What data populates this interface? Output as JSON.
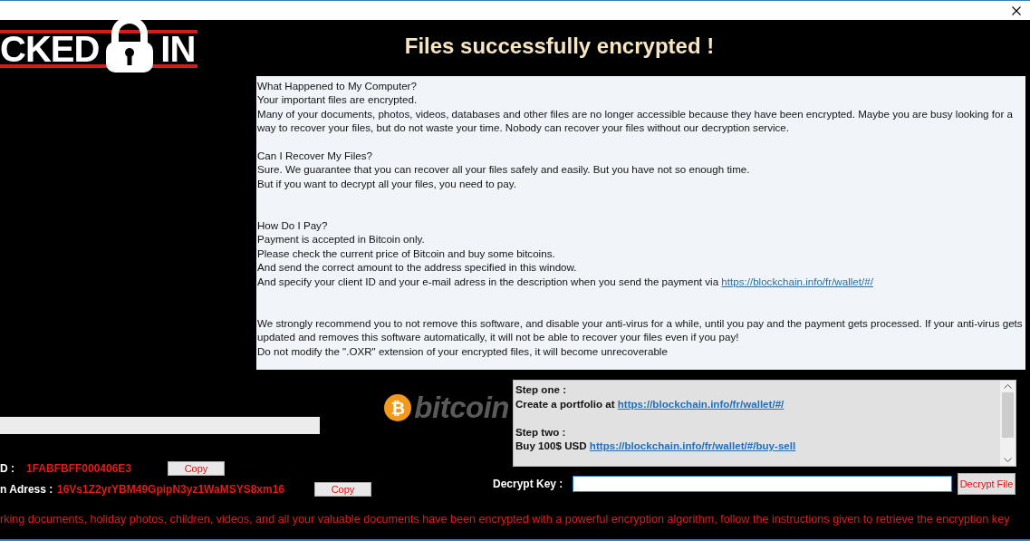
{
  "header": {
    "logo": {
      "left": "CKED",
      "right": "IN"
    },
    "title": "Files successfully encrypted !"
  },
  "note": {
    "sections": [
      {
        "lines": [
          {
            "text": "What Happened to My Computer?"
          },
          {
            "text": "Your important files are encrypted."
          },
          {
            "text": "Many of your documents, photos, videos, databases and other files are no longer accessible because they have been encrypted. Maybe you are busy looking for a way to recover your files, but do not waste your time. Nobody can recover your files without our decryption service."
          }
        ]
      },
      {
        "lines": [
          {
            "text": "Can I Recover My Files?"
          },
          {
            "text": "Sure. We guarantee that you can recover all your files safely and easily. But you have not so enough time."
          },
          {
            "text": "But if you want to decrypt all your files, you need to pay."
          }
        ]
      },
      {
        "lines": [
          {
            "text": "How Do I Pay?"
          },
          {
            "text": "Payment is accepted in Bitcoin only."
          },
          {
            "text": "Please check the current price of Bitcoin and buy some bitcoins."
          },
          {
            "text": "And send the correct amount to the address specified in this window."
          },
          {
            "text": "And specify your client ID and your e-mail adress in the description when you send the payment via",
            "link": "https://blockchain.info/fr/wallet/#/"
          }
        ]
      },
      {
        "lines": [
          {
            "text": "We strongly recommend you to not remove this software, and disable your anti-virus for a while, until you pay and the payment gets processed. If your anti-virus gets updated and removes this software automatically, it will not be able to recover your files even if you pay!"
          },
          {
            "text": "Do not modify the \".OXR\" extension of your encrypted files, it will become unrecoverable"
          }
        ]
      }
    ]
  },
  "bitcoin_logo": {
    "symbol": "₿",
    "word": "bitcoin"
  },
  "client_id": {
    "label": "D :",
    "value": "1FABFBFF000406E3",
    "button": "Copy"
  },
  "address": {
    "label": "n Adress :",
    "value": "16Vs1Z2yrYBM49GpipN3yz1WaMSYS8xm16",
    "button": "Copy"
  },
  "steps": [
    {
      "label": "Step one :",
      "text": "Create a portfolio at",
      "link": "https://blockchain.info/fr/wallet/#/"
    },
    {
      "label": "Step two :",
      "text": "Buy 100$ USD",
      "link": "https://blockchain.info/fr/wallet/#/buy-sell"
    }
  ],
  "decrypt": {
    "label": "Decrypt Key :",
    "button": "Decrypt File"
  },
  "footer": "rking documents, holiday photos, children, videos, and all your valuable documents have been encrypted with a powerful encryption algorithm, follow the instructions given to retrieve the encryption key"
}
